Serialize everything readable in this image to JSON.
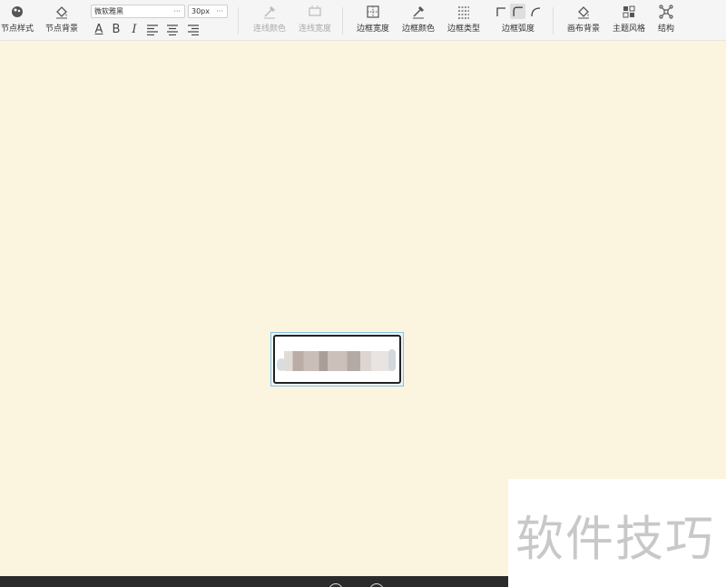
{
  "toolbar": {
    "node_style": "节点样式",
    "node_bg": "节点背景",
    "font_family": "微软雅黑",
    "font_size": "30px",
    "select_more": "···",
    "fmt_color": "A",
    "fmt_bold": "B",
    "fmt_italic": "I",
    "line_color": "连线颜色",
    "line_width": "连线宽度",
    "border_width": "边框宽度",
    "border_color": "边框颜色",
    "border_type": "边框类型",
    "border_radius": "边框弧度",
    "canvas_bg": "画布背景",
    "theme_style": "主题风格",
    "structure": "结构"
  },
  "watermark": {
    "text": "软件技巧"
  }
}
